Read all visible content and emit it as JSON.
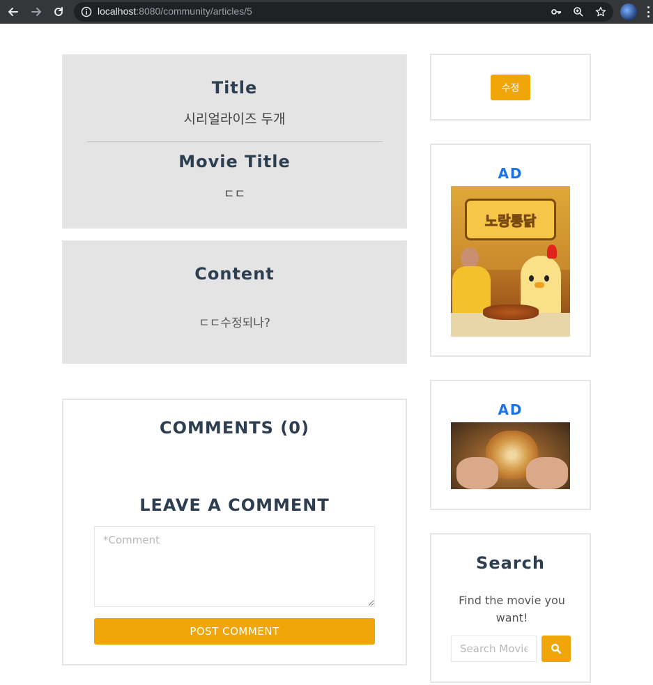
{
  "browser": {
    "url_host": "localhost",
    "url_path": ":8080/community/articles/5"
  },
  "article": {
    "title_heading": "Title",
    "title_value": "시리얼라이즈 두개",
    "movie_title_heading": "Movie Title",
    "movie_title_value": "ㄷㄷ",
    "content_heading": "Content",
    "content_value": "ㄷㄷ수정되나?"
  },
  "comments": {
    "heading": "COMMENTS (0)",
    "leave_heading": "LEAVE A COMMENT",
    "textarea_placeholder": "*Comment",
    "post_label": "POST COMMENT"
  },
  "sidebar": {
    "edit_label": "수정",
    "ad1_label": "AD",
    "ad1_logo_text": "노랑통닭",
    "ad2_label": "AD",
    "search_heading": "Search",
    "search_desc": "Find the movie you want!",
    "search_placeholder": "Search Movie",
    "search_icon": "search-icon"
  },
  "colors": {
    "accent": "#f0a608",
    "ad_label": "#1a73e8",
    "heading": "#2c3e50",
    "grey_card": "#e4e4e4"
  }
}
